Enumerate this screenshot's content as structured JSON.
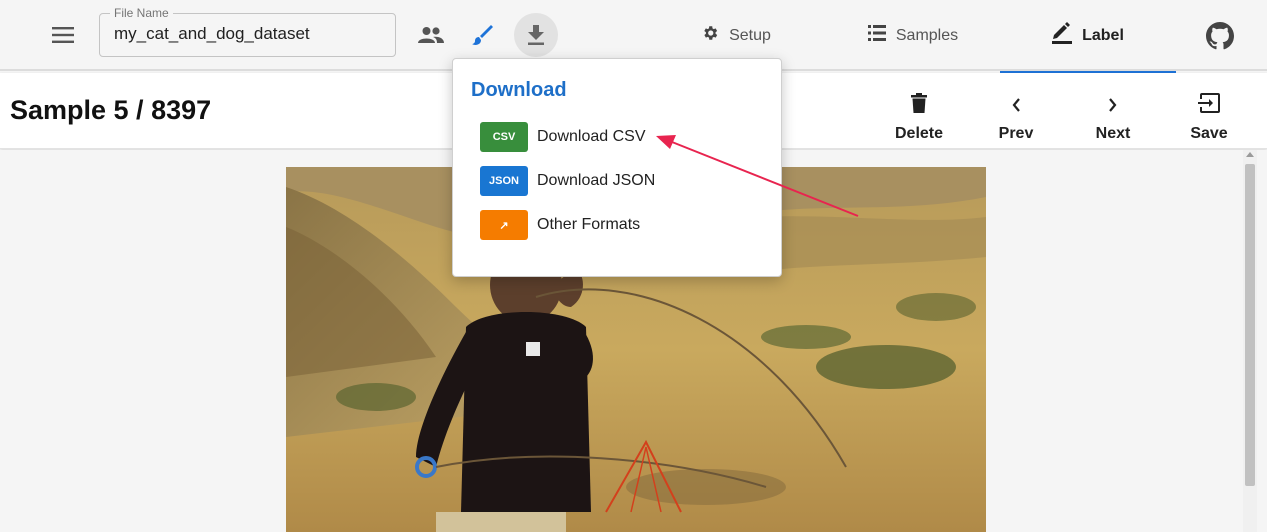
{
  "appbar": {
    "menu_icon": "hamburger-menu-icon",
    "file_name": {
      "legend": "File Name",
      "value": "my_cat_and_dog_dataset"
    },
    "icons": [
      "people-icon",
      "brush-icon",
      "download-icon"
    ],
    "tabs": [
      {
        "label": "Setup",
        "icon": "gear-icon"
      },
      {
        "label": "Samples",
        "icon": "list-icon"
      },
      {
        "label": "Label",
        "icon": "pencil-icon"
      }
    ],
    "github_icon": "github-icon"
  },
  "header": {
    "sample_title": "Sample 5 / 8397",
    "actions": [
      {
        "label": "Delete",
        "icon": "trash-icon"
      },
      {
        "label": "Prev",
        "icon": "chevron-left-icon"
      },
      {
        "label": "Next",
        "icon": "chevron-right-icon"
      },
      {
        "label": "Save",
        "icon": "exit-save-icon"
      }
    ]
  },
  "download_menu": {
    "title": "Download",
    "items": [
      {
        "badge": "CSV",
        "label": "Download CSV",
        "color": "#388e3c"
      },
      {
        "badge": "JSON",
        "label": "Download JSON",
        "color": "#1976d2"
      },
      {
        "badge": "↗",
        "label": "Other Formats",
        "color": "#f57c00"
      }
    ]
  },
  "colors": {
    "accent": "#1e73d8",
    "annotation_arrow": "#e8244f"
  }
}
